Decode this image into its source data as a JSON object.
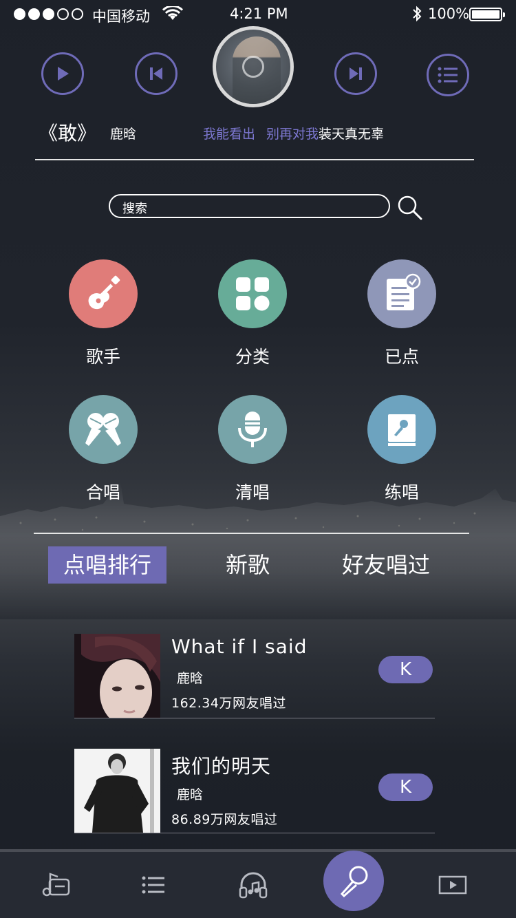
{
  "status_bar": {
    "carrier": "中国移动",
    "time": "4:21 PM",
    "battery": "100%",
    "signal_strength": 3,
    "signal_max": 5
  },
  "player": {
    "song_title": "《敢》",
    "artist": "鹿晗",
    "lyric_highlight_1": "我能看出",
    "lyric_highlight_2": "别再对我",
    "lyric_normal": "装天真无辜",
    "accent_color": "#6f6bb8"
  },
  "search": {
    "placeholder": "搜索"
  },
  "categories": [
    {
      "label": "歌手",
      "icon": "guitar-icon",
      "color": "#e07c79"
    },
    {
      "label": "分类",
      "icon": "grid-icon",
      "color": "#67ac98"
    },
    {
      "label": "已点",
      "icon": "checklist-icon",
      "color": "#8f97b8"
    },
    {
      "label": "合唱",
      "icon": "duet-mic-icon",
      "color": "#77a4a9"
    },
    {
      "label": "清唱",
      "icon": "microphone-icon",
      "color": "#77a4a9"
    },
    {
      "label": "练唱",
      "icon": "practice-book-icon",
      "color": "#6da3bf"
    }
  ],
  "tabs": [
    {
      "label": "点唱排行",
      "active": true
    },
    {
      "label": "新歌",
      "active": false
    },
    {
      "label": "好友唱过",
      "active": false
    }
  ],
  "songs": [
    {
      "title": "What if I said",
      "artist": "鹿晗",
      "count": "162.34万网友唱过",
      "button": "K"
    },
    {
      "title": "我们的明天",
      "artist": "鹿晗",
      "count": "86.89万网友唱过",
      "button": "K"
    }
  ],
  "tabbar": {
    "items": [
      "music-note-icon",
      "list-icon",
      "headphones-icon",
      "microphone-icon",
      "video-icon"
    ],
    "active": "microphone-icon"
  }
}
